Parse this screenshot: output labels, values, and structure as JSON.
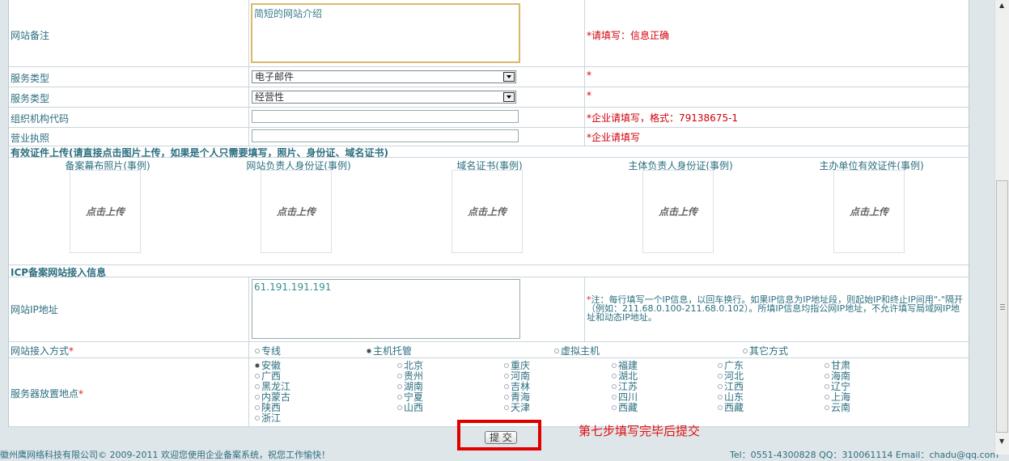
{
  "rows": {
    "remark": {
      "label": "网站备注",
      "value": "简短的网站介绍",
      "hint_star": "*",
      "hint": "请填写：信息正确"
    },
    "service_type_1": {
      "label": "服务类型",
      "value": "电子邮件",
      "hint_star": "*"
    },
    "service_type_2": {
      "label": "服务类型",
      "value": "经营性",
      "hint_star": "*"
    },
    "org_code": {
      "label": "组织机构代码",
      "hint_star": "*",
      "hint": "企业请填写，格式：79138675-1"
    },
    "license": {
      "label": "营业执照",
      "hint_star": "*",
      "hint": "企业请填写"
    }
  },
  "upload": {
    "heading": "有效证件上传(请直接点击图片上传，如果是个人只需要填写，照片、身份证、域名证书)",
    "button_text": "点击上传",
    "items": [
      {
        "label": "备案幕布照片(事例)"
      },
      {
        "label": "网站负责人身份证(事例)"
      },
      {
        "label": "域名证书(事例)"
      },
      {
        "label": "主体负责人身份证(事例)"
      },
      {
        "label": "主办单位有效证件(事例)"
      }
    ]
  },
  "icp": {
    "heading": "ICP备案网站接入信息",
    "ip_label": "网站IP地址",
    "ip_value": "61.191.191.191",
    "ip_note_star": "*",
    "ip_note": "注：每行填写一个IP信息，以回车换行。如果IP信息为IP地址段，则起始IP和终止IP间用\"-\"隔开（例如：211.68.0.100-211.68.0.102）。所填IP信息均指公网IP地址，不允许填写局域网IP地址和动态IP地址。",
    "access_label": "网站接入方式",
    "access_options": [
      {
        "label": "专线",
        "checked": false
      },
      {
        "label": "主机托管",
        "checked": true
      },
      {
        "label": "虚拟主机",
        "checked": false
      },
      {
        "label": "其它方式",
        "checked": false
      }
    ],
    "location_label": "服务器放置地点",
    "provinces": [
      {
        "label": "安徽",
        "checked": true
      },
      {
        "label": "北京"
      },
      {
        "label": "重庆"
      },
      {
        "label": "福建"
      },
      {
        "label": "广东"
      },
      {
        "label": "甘肃"
      },
      {
        "label": "广西"
      },
      {
        "label": "贵州"
      },
      {
        "label": "河南"
      },
      {
        "label": "湖北"
      },
      {
        "label": "河北"
      },
      {
        "label": "海南"
      },
      {
        "label": "黑龙江"
      },
      {
        "label": "湖南"
      },
      {
        "label": "吉林"
      },
      {
        "label": "江苏"
      },
      {
        "label": "江西"
      },
      {
        "label": "辽宁"
      },
      {
        "label": "内蒙古"
      },
      {
        "label": "宁夏"
      },
      {
        "label": "青海"
      },
      {
        "label": "四川"
      },
      {
        "label": "山东"
      },
      {
        "label": "上海"
      },
      {
        "label": "陕西"
      },
      {
        "label": "山西"
      },
      {
        "label": "天津"
      },
      {
        "label": "西藏"
      },
      {
        "label": "西藏"
      },
      {
        "label": "云南"
      },
      {
        "label": "浙江"
      }
    ]
  },
  "submit_label": "提 交",
  "annotation": "第七步填写完毕后提交",
  "footer": {
    "left": "徽州鹰网络科技有限公司© 2009-2011 欢迎您使用企业备案系统，祝您工作愉快！",
    "right": "Tel：0551-4300828 QQ：310061114 Email：chadu@qq.com"
  },
  "colors": {
    "label": "#2c6e7f",
    "hint": "#d0000b",
    "annotation": "#e01010"
  }
}
